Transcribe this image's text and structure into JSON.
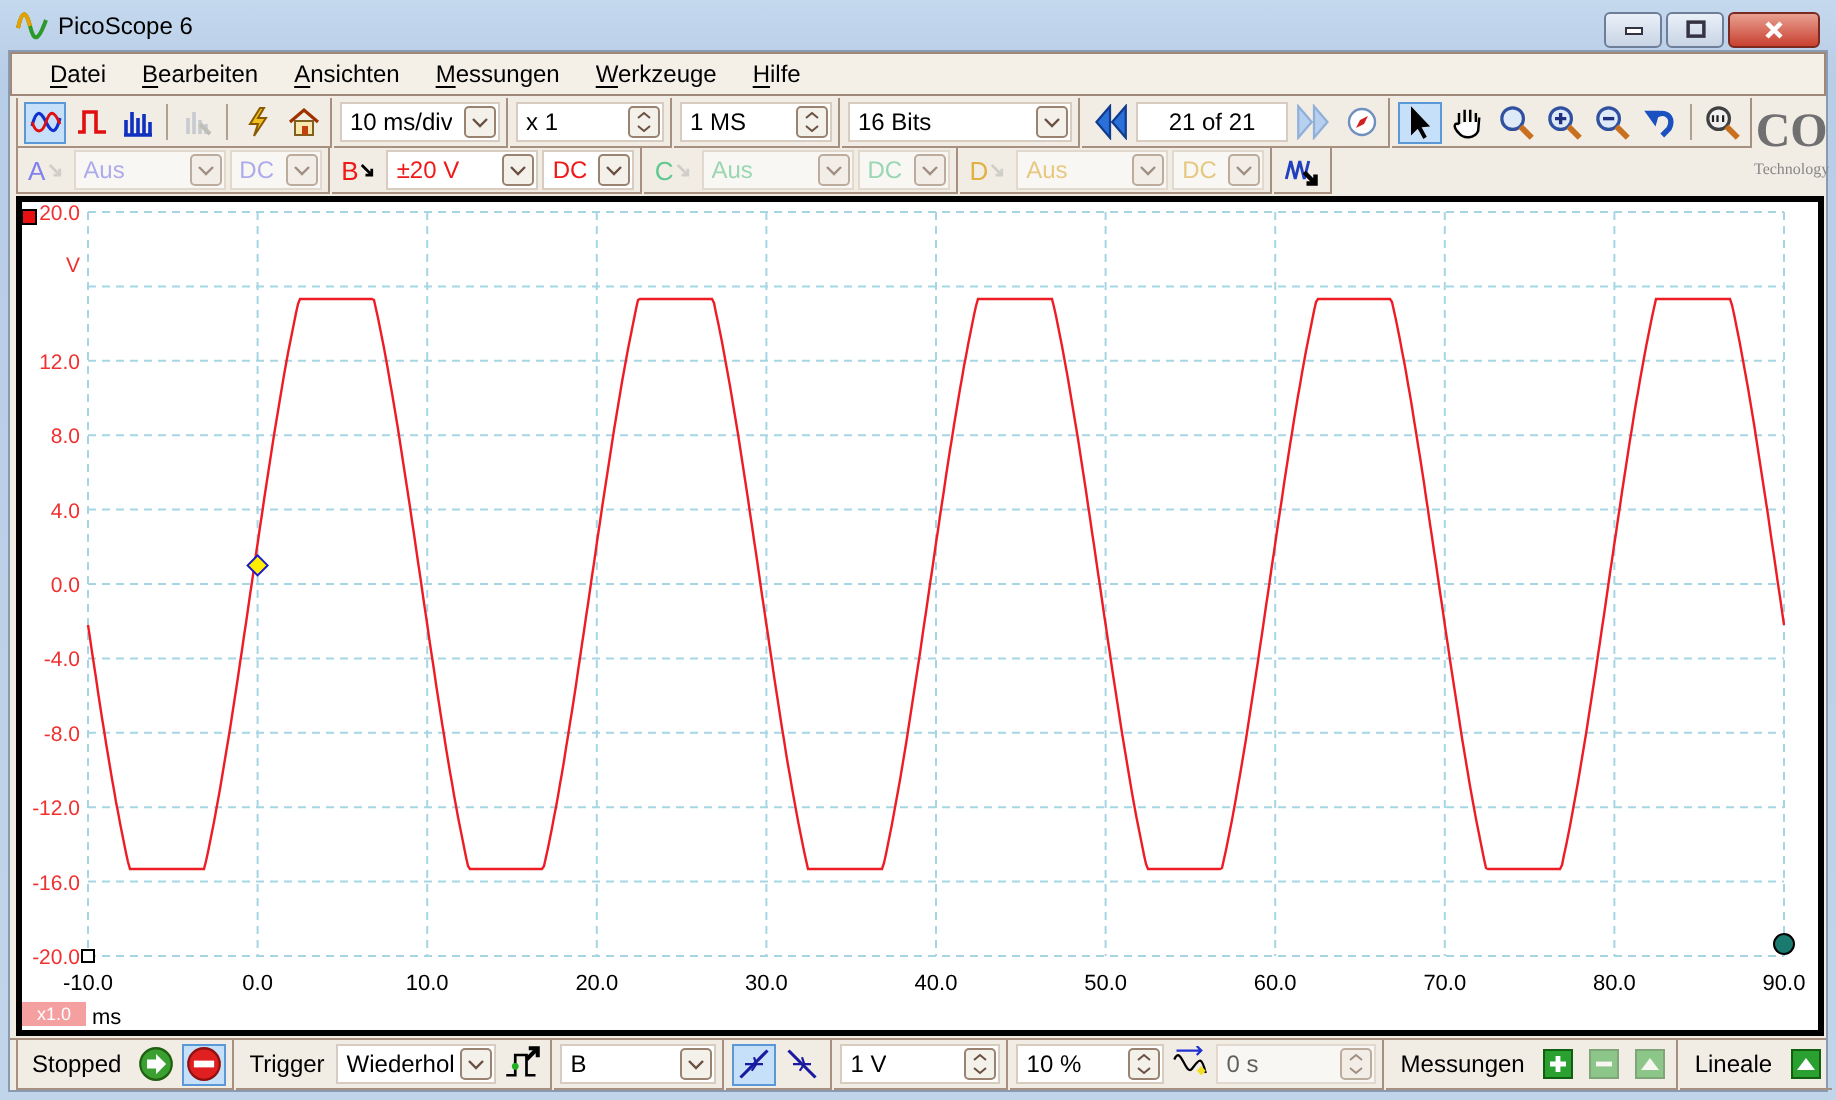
{
  "window": {
    "title": "PicoScope 6"
  },
  "menu": [
    {
      "label": "Datei"
    },
    {
      "label": "Bearbeiten"
    },
    {
      "label": "Ansichten"
    },
    {
      "label": "Messungen"
    },
    {
      "label": "Werkzeuge"
    },
    {
      "label": "Hilfe"
    }
  ],
  "toolbar": {
    "view_modes": [
      {
        "kind": "scope",
        "selected": true,
        "disabled": false
      },
      {
        "kind": "persistence",
        "selected": false,
        "disabled": false
      },
      {
        "kind": "spectrum",
        "selected": false,
        "disabled": false
      },
      {
        "kind": "xy",
        "selected": false,
        "disabled": true
      }
    ],
    "timebase": "10 ms/div",
    "zoom": "x 1",
    "samples": "1 MS",
    "resolution": "16 Bits",
    "buffer": "21 of 21",
    "tools": [
      {
        "kind": "pointer",
        "selected": true
      },
      {
        "kind": "hand",
        "selected": false
      },
      {
        "kind": "zoom-box",
        "selected": false
      },
      {
        "kind": "zoom-in",
        "selected": false
      },
      {
        "kind": "zoom-out",
        "selected": false
      },
      {
        "kind": "undo",
        "selected": false
      },
      {
        "kind": "zoom-full",
        "selected": false
      }
    ]
  },
  "logo": {
    "text": "CO",
    "subtext": "Technology"
  },
  "channels": [
    {
      "letter": "A",
      "range": "Aus",
      "coupling": "DC",
      "enabled": false,
      "color": "#8080f0"
    },
    {
      "letter": "B",
      "range": "±20 V",
      "coupling": "DC",
      "enabled": true,
      "color": "#f01818"
    },
    {
      "letter": "C",
      "range": "Aus",
      "coupling": "DC",
      "enabled": false,
      "color": "#60c890"
    },
    {
      "letter": "D",
      "range": "Aus",
      "coupling": "DC",
      "enabled": false,
      "color": "#e0b040"
    }
  ],
  "plot": {
    "y_labels": [
      "20.0",
      "12.0",
      "8.0",
      "4.0",
      "0.0",
      "-4.0",
      "-8.0",
      "-12.0",
      "-16.0",
      "-20.0"
    ],
    "y_unit": "V",
    "x_labels": [
      "-10.0",
      "0.0",
      "10.0",
      "20.0",
      "30.0",
      "40.0",
      "50.0",
      "60.0",
      "70.0",
      "80.0",
      "90.0"
    ],
    "x_unit": "ms",
    "zoom": "x1.0"
  },
  "status": {
    "state": "Stopped",
    "run_buttons": [
      {
        "kind": "start",
        "selected": false
      },
      {
        "kind": "stop",
        "selected": true
      }
    ],
    "trigger_label": "Trigger",
    "trigger_mode": "Wiederhol",
    "source": "B",
    "edges": [
      {
        "kind": "rising",
        "selected": true
      },
      {
        "kind": "falling",
        "selected": false
      }
    ],
    "threshold": "1 V",
    "pretrigger": "10 %",
    "delay": {
      "value": "0 s",
      "disabled": true
    },
    "measurements": {
      "label": "Messungen",
      "buttons": [
        {
          "kind": "add",
          "disabled": false
        },
        {
          "kind": "remove",
          "disabled": true
        },
        {
          "kind": "edit",
          "disabled": true
        }
      ]
    },
    "rulers": {
      "label": "Lineale"
    }
  }
}
